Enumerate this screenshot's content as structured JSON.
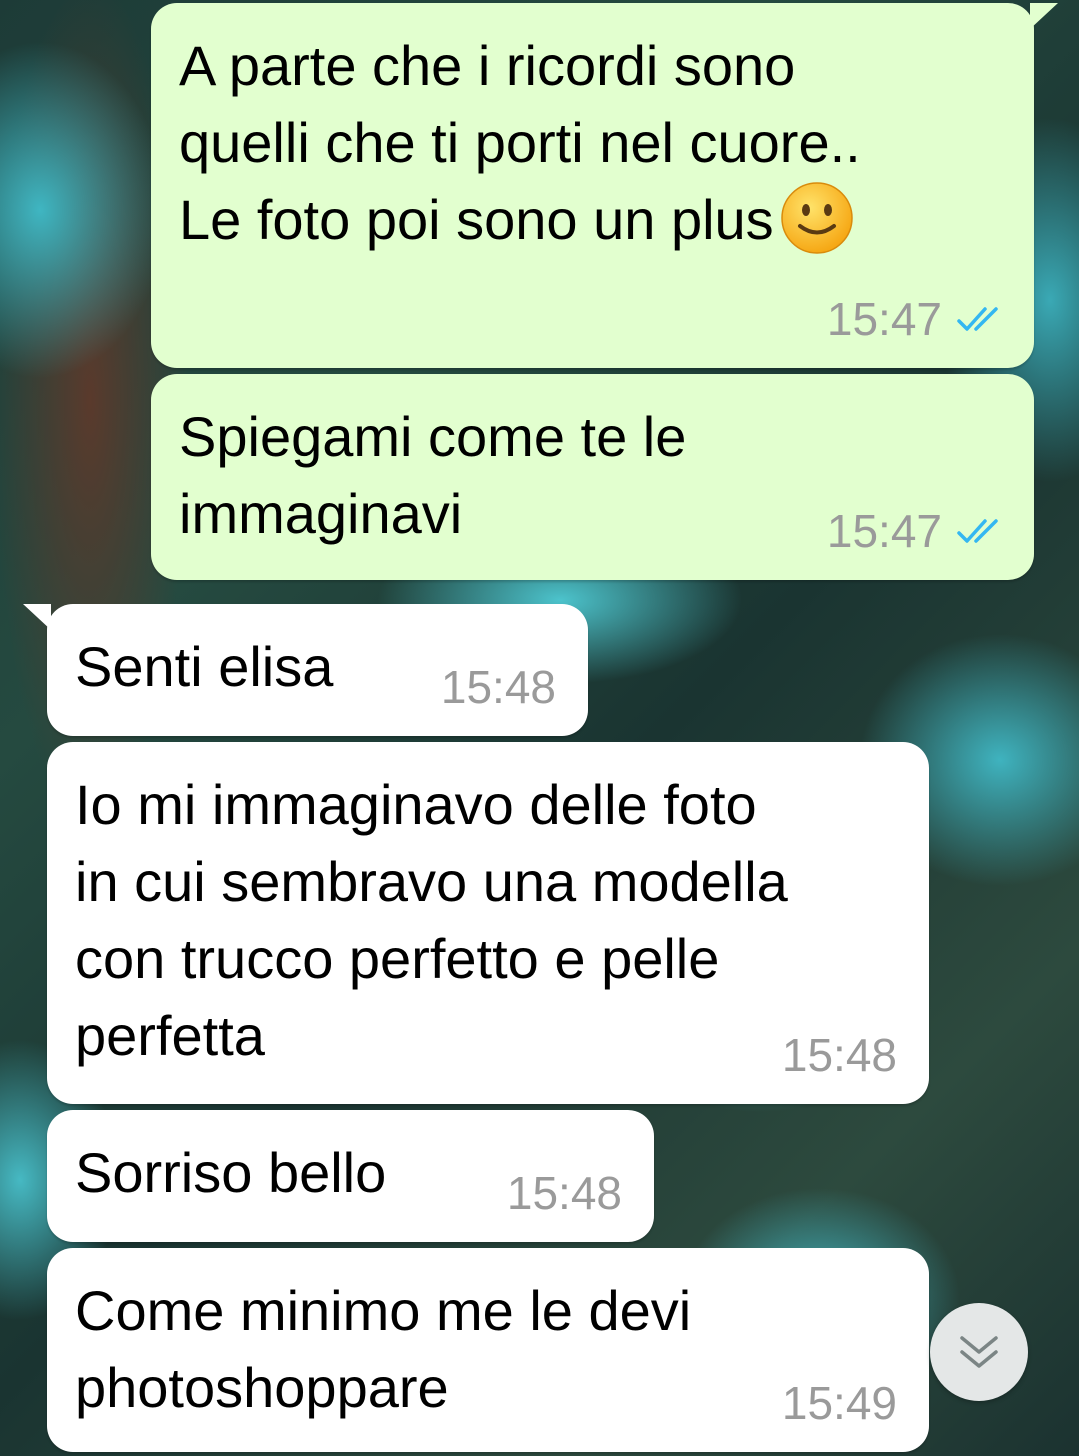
{
  "chat": {
    "messages": [
      {
        "direction": "outgoing",
        "text": "A parte che i ricordi sono\nquelli che ti porti nel cuore..\nLe foto poi sono un plus",
        "emoji": "slightly-smiling-face",
        "time": "15:47",
        "status": "read"
      },
      {
        "direction": "outgoing",
        "text": "Spiegami come te le\nimmaginavi",
        "time": "15:47",
        "status": "read"
      },
      {
        "direction": "incoming",
        "text": "Senti elisa",
        "time": "15:48"
      },
      {
        "direction": "incoming",
        "text": "Io mi immaginavo delle foto\nin cui sembravo una modella\ncon trucco perfetto e pelle\nperfetta",
        "time": "15:48"
      },
      {
        "direction": "incoming",
        "text": "Sorriso bello",
        "time": "15:48"
      },
      {
        "direction": "incoming",
        "text": "Come minimo me le devi\nphotoshoppare",
        "time": "15:49"
      }
    ]
  },
  "colors": {
    "outgoing_bubble": "#e2ffcf",
    "incoming_bubble": "#ffffff",
    "read_ticks": "#34b7f1",
    "timestamp": "#9a9a9a"
  },
  "icons": {
    "read_receipt": "double-check-icon",
    "scroll_down": "chevron-double-down-icon",
    "emoji": "smiley-emoji-icon"
  }
}
